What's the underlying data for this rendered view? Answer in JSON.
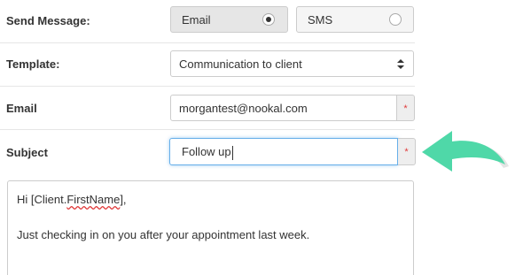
{
  "form": {
    "send_message": {
      "label": "Send Message:",
      "options": [
        {
          "label": "Email",
          "selected": true
        },
        {
          "label": "SMS",
          "selected": false
        }
      ]
    },
    "template": {
      "label": "Template:",
      "value": "Communication to client"
    },
    "email": {
      "label": "Email",
      "value": "morgantest@nookal.com",
      "required_marker": "*"
    },
    "subject": {
      "label": "Subject",
      "value": "Follow up",
      "required_marker": "*"
    },
    "body": {
      "greeting_prefix": "Hi [Client.",
      "greeting_token": "FirstName",
      "greeting_suffix": "],",
      "line2": "Just checking in on you after your appointment last week."
    }
  },
  "colors": {
    "arrow": "#4fd8a8",
    "focus_border": "#66afe9",
    "required": "#e03a3a"
  },
  "icons": {
    "select_arrows": "sort-arrows-icon",
    "pointer_arrow": "curved-arrow-icon"
  }
}
